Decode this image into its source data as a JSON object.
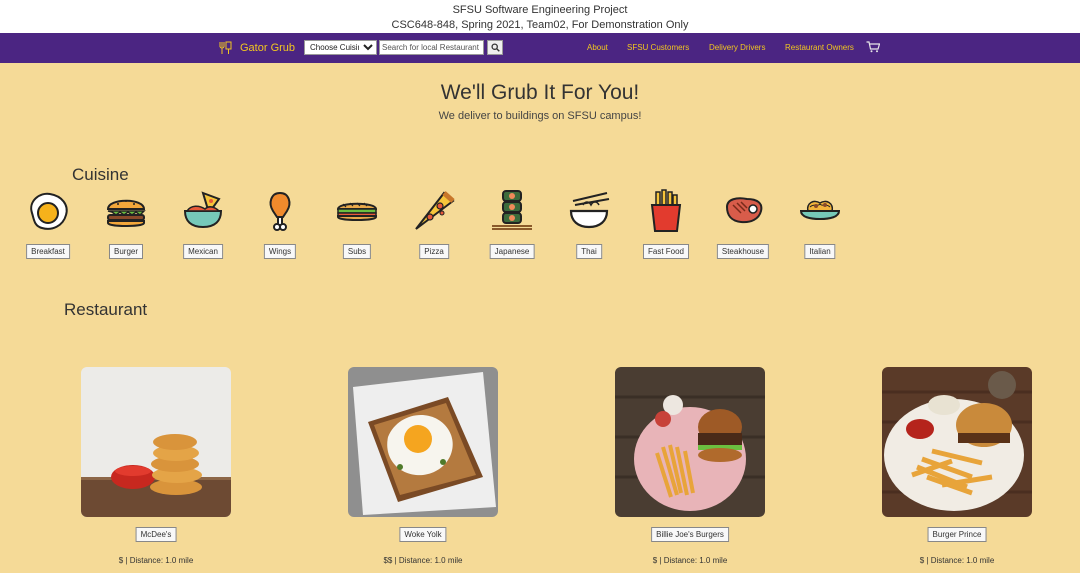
{
  "banner": {
    "line1": "SFSU Software Engineering Project",
    "line2": "CSC648-848, Spring 2021, Team02, For Demonstration Only"
  },
  "nav": {
    "brand": "Gator Grub",
    "brand_icon": "restaurant-logo-icon",
    "cuisine_select": "Choose Cuisine",
    "search_placeholder": "Search for local Restaurant",
    "search_icon": "search-icon",
    "links": [
      "About",
      "SFSU Customers",
      "Delivery Drivers",
      "Restaurant Owners"
    ],
    "cart_icon": "cart-icon",
    "accent_color": "#f2c81f",
    "bar_color": "#4b2582"
  },
  "hero": {
    "title": "We'll Grub It For You!",
    "subtitle": "We deliver to buildings on SFSU campus!"
  },
  "cuisine": {
    "title": "Cuisine",
    "items": [
      {
        "label": "Breakfast",
        "icon": "fried-egg-icon"
      },
      {
        "label": "Burger",
        "icon": "burger-icon"
      },
      {
        "label": "Mexican",
        "icon": "nachos-icon"
      },
      {
        "label": "Wings",
        "icon": "drumstick-icon"
      },
      {
        "label": "Subs",
        "icon": "sub-sandwich-icon"
      },
      {
        "label": "Pizza",
        "icon": "pizza-slice-icon"
      },
      {
        "label": "Japanese",
        "icon": "sushi-icon"
      },
      {
        "label": "Thai",
        "icon": "noodle-bowl-icon"
      },
      {
        "label": "Fast Food",
        "icon": "fries-icon"
      },
      {
        "label": "Steakhouse",
        "icon": "steak-icon"
      },
      {
        "label": "Italian",
        "icon": "pasta-icon"
      }
    ]
  },
  "restaurants": {
    "title": "Restaurant",
    "items": [
      {
        "name": "McDee's",
        "meta": "$ | Distance: 1.0 mile",
        "image": "chicken-nuggets-photo"
      },
      {
        "name": "Woke Yolk",
        "meta": "$$ | Distance: 1.0 mile",
        "image": "egg-toast-photo"
      },
      {
        "name": "Billie Joe's Burgers",
        "meta": "$ | Distance: 1.0 mile",
        "image": "burger-fries-photo"
      },
      {
        "name": "Burger Prince",
        "meta": "$ | Distance: 1.0 mile",
        "image": "burger-plate-photo"
      }
    ]
  }
}
